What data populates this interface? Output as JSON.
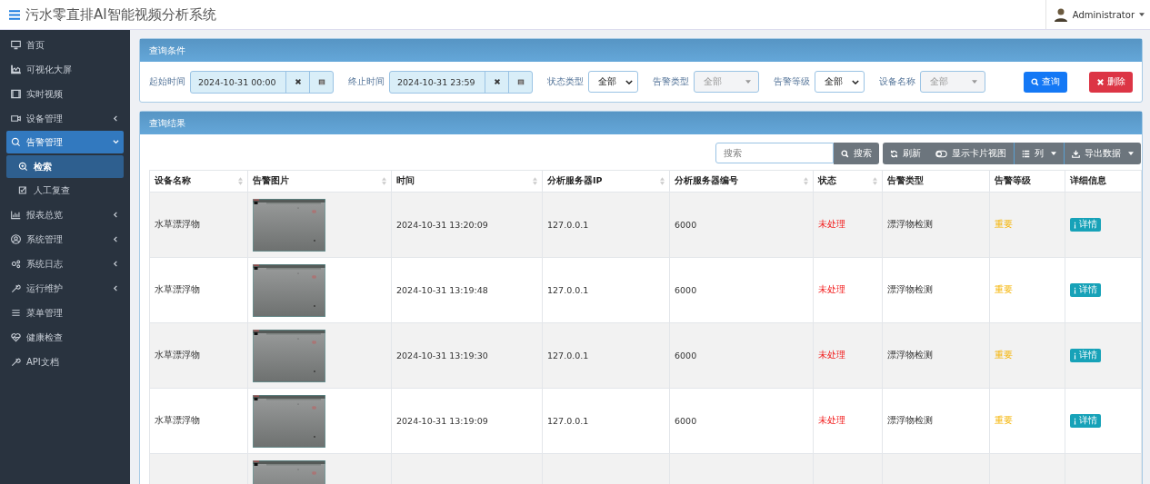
{
  "app": {
    "title": "污水零直排AI智能视频分析系统",
    "user": "Administrator"
  },
  "sidebar": {
    "items": [
      {
        "label": "首页",
        "selected": false
      },
      {
        "label": "可视化大屏",
        "selected": false
      },
      {
        "label": "实时视频",
        "selected": false
      },
      {
        "label": "设备管理",
        "selected": false,
        "expanded": false
      },
      {
        "label": "告警管理",
        "selected": true,
        "expanded": true,
        "children": [
          {
            "label": "检索",
            "selected": true
          },
          {
            "label": "人工复查",
            "selected": false
          }
        ]
      },
      {
        "label": "报表总览",
        "selected": false,
        "expanded": false
      },
      {
        "label": "系统管理",
        "selected": false,
        "expanded": false
      },
      {
        "label": "系统日志",
        "selected": false,
        "expanded": false
      },
      {
        "label": "运行维护",
        "selected": false,
        "expanded": false
      },
      {
        "label": "菜单管理",
        "selected": false
      },
      {
        "label": "健康检查",
        "selected": false
      },
      {
        "label": "API文档",
        "selected": false
      }
    ]
  },
  "query_panel": {
    "title": "查询条件",
    "filters": [
      {
        "kind": "date",
        "label": "起始时间",
        "value": "2024-10-31 00:00"
      },
      {
        "kind": "date",
        "label": "终止时间",
        "value": "2024-10-31 23:59"
      },
      {
        "kind": "select",
        "label": "状态类型",
        "value": "全部",
        "disabled": false
      },
      {
        "kind": "select",
        "label": "告警类型",
        "placeholder": "全部",
        "disabled": true
      },
      {
        "kind": "select",
        "label": "告警等级",
        "value": "全部",
        "disabled": false
      },
      {
        "kind": "select",
        "label": "设备名称",
        "placeholder": "全部",
        "disabled": true
      }
    ],
    "query_button": "查询",
    "delete_button": "删除"
  },
  "results_panel": {
    "title": "查询结果",
    "toolbar": {
      "search_placeholder": "搜索",
      "search_button": "搜索",
      "refresh_button": "刷新",
      "card_view_button": "显示卡片视图",
      "columns_button": "列",
      "export_button": "导出数据"
    },
    "table": {
      "columns": [
        {
          "label": "设备名称",
          "sortable": true
        },
        {
          "label": "告警图片",
          "sortable": true
        },
        {
          "label": "时间",
          "sortable": true
        },
        {
          "label": "分析服务器IP",
          "sortable": true
        },
        {
          "label": "分析服务器编号",
          "sortable": true
        },
        {
          "label": "状态",
          "sortable": true
        },
        {
          "label": "告警类型",
          "sortable": false
        },
        {
          "label": "告警等级",
          "sortable": false
        },
        {
          "label": "详细信息",
          "sortable": false
        }
      ],
      "rows": [
        {
          "device": "水草漂浮物",
          "image": {
            "kind": "picture"
          },
          "time": "2024-10-31 13:20:09",
          "ip": "127.0.0.1",
          "server_no": "6000",
          "status": "未处理",
          "type": "漂浮物检测",
          "level": "重要",
          "detail_button": "详情"
        },
        {
          "device": "水草漂浮物",
          "image": {
            "kind": "picture"
          },
          "time": "2024-10-31 13:19:48",
          "ip": "127.0.0.1",
          "server_no": "6000",
          "status": "未处理",
          "type": "漂浮物检测",
          "level": "重要",
          "detail_button": "详情"
        },
        {
          "device": "水草漂浮物",
          "image": {
            "kind": "picture"
          },
          "time": "2024-10-31 13:19:30",
          "ip": "127.0.0.1",
          "server_no": "6000",
          "status": "未处理",
          "type": "漂浮物检测",
          "level": "重要",
          "detail_button": "详情"
        },
        {
          "device": "水草漂浮物",
          "image": {
            "kind": "picture"
          },
          "time": "2024-10-31 13:19:09",
          "ip": "127.0.0.1",
          "server_no": "6000",
          "status": "未处理",
          "type": "漂浮物检测",
          "level": "重要",
          "detail_button": "详情"
        },
        {
          "image": {
            "kind": "picture"
          }
        }
      ]
    }
  }
}
